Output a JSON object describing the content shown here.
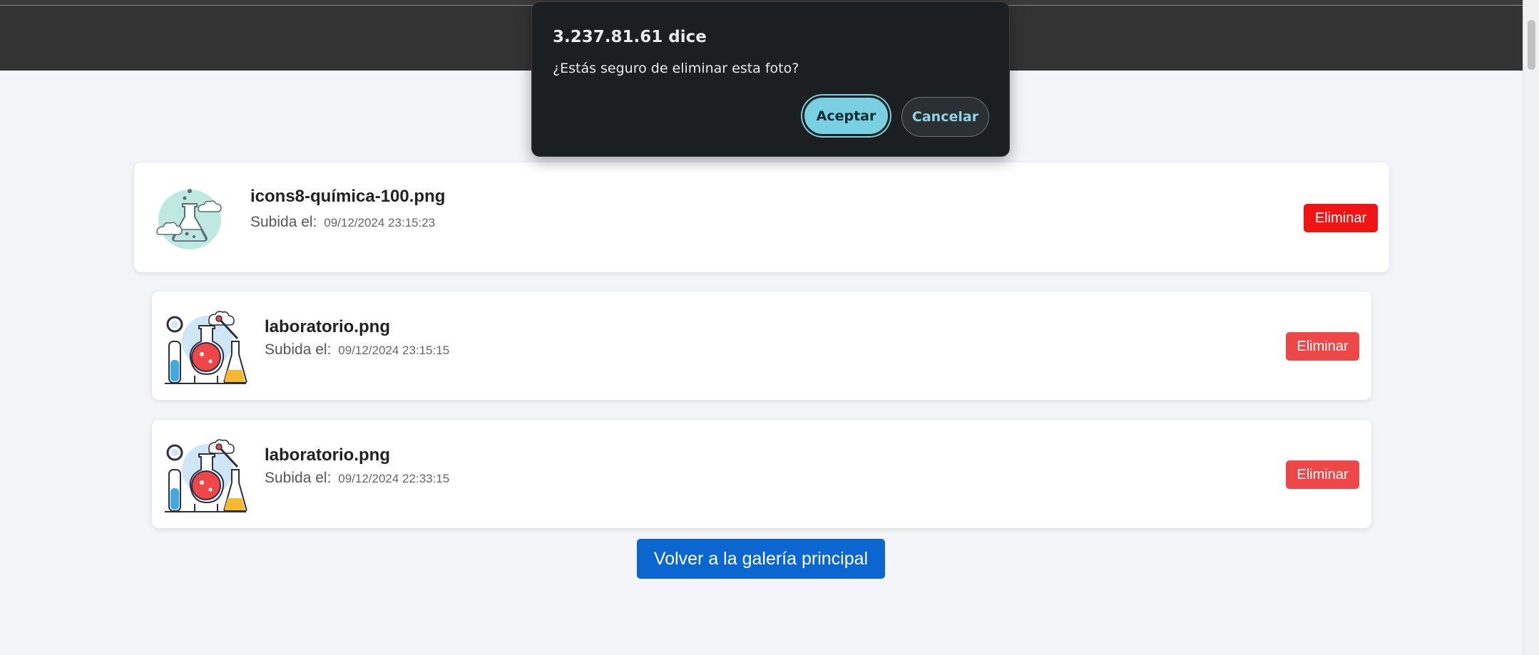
{
  "dialog": {
    "title": "3.237.81.61 dice",
    "message": "¿Estás seguro de eliminar esta foto?",
    "accept_label": "Aceptar",
    "cancel_label": "Cancelar"
  },
  "photos": [
    {
      "name": "icons8-química-100.png",
      "uploaded_label": "Subida el:",
      "date": "09/12/2024 23:15:23",
      "delete_label": "Eliminar",
      "icon": "chemistry-flask-icon"
    },
    {
      "name": "laboratorio.png",
      "uploaded_label": "Subida el:",
      "date": "09/12/2024 23:15:15",
      "delete_label": "Eliminar",
      "icon": "laboratory-icon"
    },
    {
      "name": "laboratorio.png",
      "uploaded_label": "Subida el:",
      "date": "09/12/2024 22:33:15",
      "delete_label": "Eliminar",
      "icon": "laboratory-icon"
    }
  ],
  "back_button_label": "Volver a la galería principal",
  "colors": {
    "header": "#333333",
    "background": "#f4f5f9",
    "delete_active": "#f01515",
    "delete": "#ef4747",
    "back_button": "#0b67cf",
    "dialog_bg": "#1b1f22",
    "dialog_accept": "#79d0e0"
  }
}
